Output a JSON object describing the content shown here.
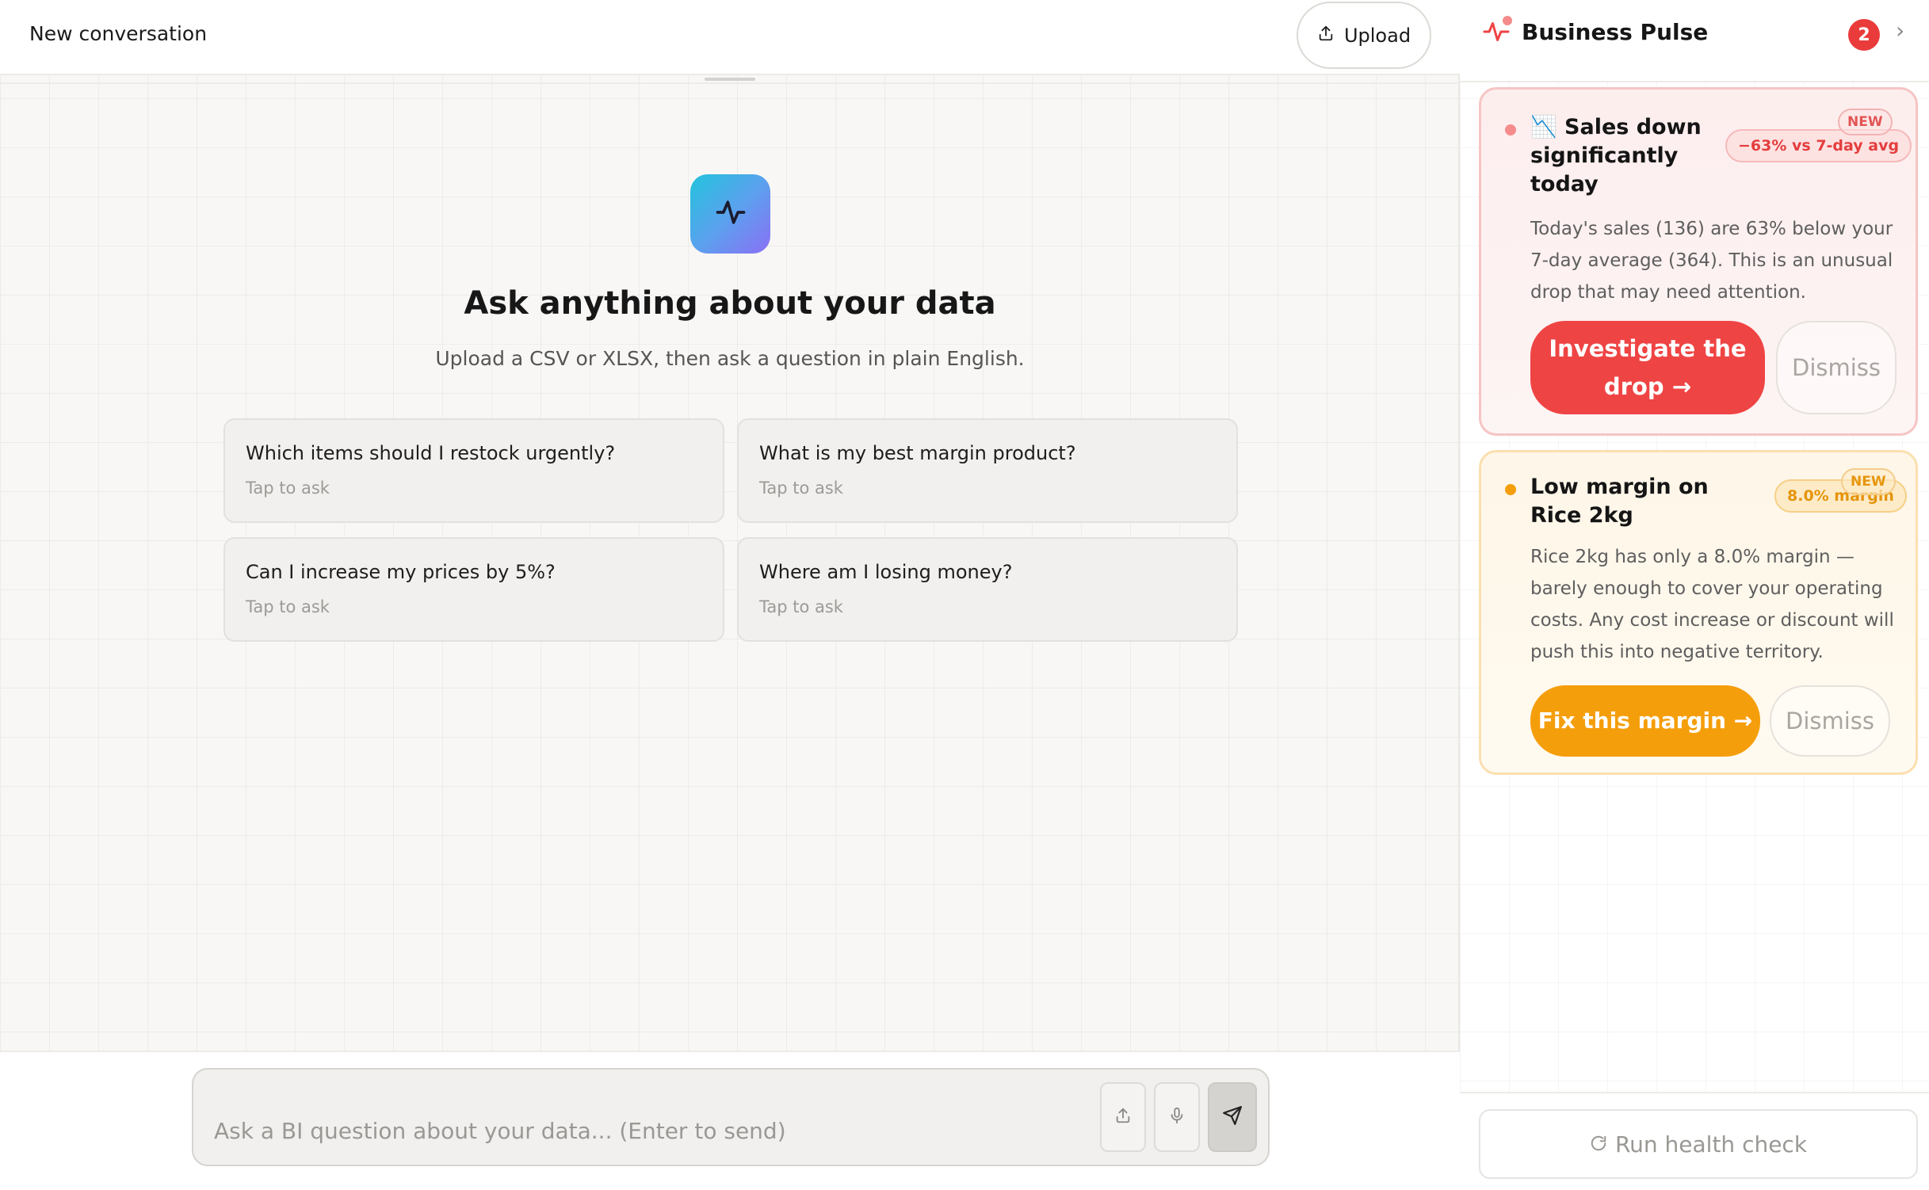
{
  "header": {
    "conversation_title": "New conversation",
    "upload_label": "Upload"
  },
  "hero": {
    "title": "Ask anything about your data",
    "subtitle": "Upload a CSV or XLSX, then ask a question in plain English."
  },
  "suggestions": [
    {
      "question": "Which items should I restock urgently?",
      "hint": "Tap to ask"
    },
    {
      "question": "What is my best margin product?",
      "hint": "Tap to ask"
    },
    {
      "question": "Can I increase my prices by 5%?",
      "hint": "Tap to ask"
    },
    {
      "question": "Where am I losing money?",
      "hint": "Tap to ask"
    }
  ],
  "composer": {
    "placeholder": "Ask a BI question about your data... (Enter to send)"
  },
  "pulse": {
    "title": "Business Pulse",
    "count": "2",
    "alerts": [
      {
        "emoji": "📉",
        "title": "Sales down significantly today",
        "chip": "−63% vs 7-day avg",
        "badge": "NEW",
        "body": "Today's sales (136) are 63% below your 7-day average (364). This is an unusual drop that may need attention.",
        "action": "Investigate the drop →",
        "dismiss": "Dismiss",
        "color": "#ef4444"
      },
      {
        "title": "Low margin on Rice 2kg",
        "chip": "8.0% margin",
        "badge": "NEW",
        "body": "Rice 2kg has only a 8.0% margin — barely enough to cover your operating costs. Any cost increase or discount will push this into negative territory.",
        "action": "Fix this margin →",
        "dismiss": "Dismiss",
        "color": "#f59e0b"
      }
    ],
    "health_check": "Run health check"
  },
  "colors": {
    "danger": "#ef4444",
    "warning": "#f59e0b",
    "logo_gradient_start": "#22c3dd",
    "logo_gradient_end": "#8b6ff5"
  }
}
